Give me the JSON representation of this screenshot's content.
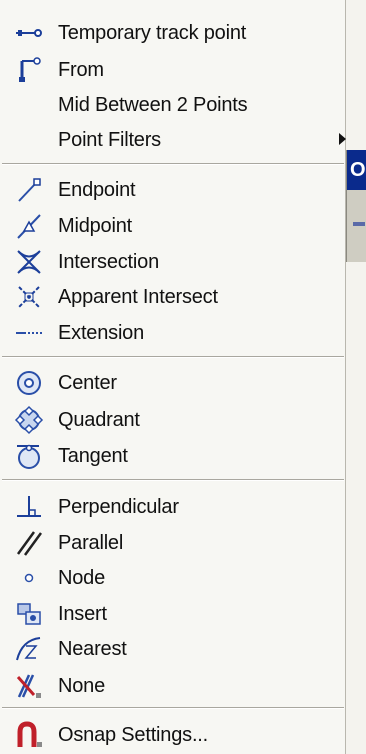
{
  "menu": {
    "items": [
      {
        "label": "Temporary track point",
        "icon": "temporary-track-point-icon"
      },
      {
        "label": "From",
        "icon": "from-icon"
      },
      {
        "label": "Mid Between 2 Points",
        "icon": ""
      },
      {
        "label": "Point Filters",
        "icon": "",
        "submenu": true
      },
      {
        "label": "Endpoint",
        "icon": "endpoint-icon"
      },
      {
        "label": "Midpoint",
        "icon": "midpoint-icon"
      },
      {
        "label": "Intersection",
        "icon": "intersection-icon"
      },
      {
        "label": "Apparent Intersect",
        "icon": "apparent-intersect-icon"
      },
      {
        "label": "Extension",
        "icon": "extension-icon"
      },
      {
        "label": "Center",
        "icon": "center-icon"
      },
      {
        "label": "Quadrant",
        "icon": "quadrant-icon"
      },
      {
        "label": "Tangent",
        "icon": "tangent-icon"
      },
      {
        "label": "Perpendicular",
        "icon": "perpendicular-icon"
      },
      {
        "label": "Parallel",
        "icon": "parallel-icon"
      },
      {
        "label": "Node",
        "icon": "node-icon"
      },
      {
        "label": "Insert",
        "icon": "insert-icon"
      },
      {
        "label": "Nearest",
        "icon": "nearest-icon"
      },
      {
        "label": "None",
        "icon": "none-icon"
      },
      {
        "label": "Osnap Settings...",
        "icon": "osnap-settings-icon"
      }
    ]
  },
  "submenu_flyout": {
    "title": "O"
  },
  "colors": {
    "accent": "#0a2a8c",
    "icon_blue": "#2a4fa8",
    "icon_red": "#c0202a"
  }
}
